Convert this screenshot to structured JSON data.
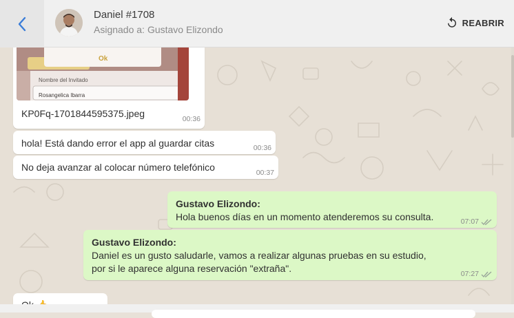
{
  "header": {
    "contact_name": "Daniel #1708",
    "assigned_label": "Asignado a:",
    "assigned_to": "Gustavo Elizondo",
    "reopen_label": "REABRIR"
  },
  "image_message": {
    "preview_field_label": "Nombre del Invitado",
    "preview_field_value": "Rosangelica Ibarra",
    "preview_ok": "Ok",
    "filename": "KP0Fq-1701844595375.jpeg",
    "time": "00:36"
  },
  "messages": [
    {
      "text": "hola! Está dando error el app al guardar citas",
      "time": "00:36"
    },
    {
      "text": "No deja avanzar al colocar número telefónico",
      "time": "00:37"
    },
    {
      "sender": "Gustavo Elizondo:",
      "lines": [
        "Hola buenos días en un momento atenderemos su consulta."
      ],
      "time": "07:07"
    },
    {
      "sender": "Gustavo Elizondo:",
      "lines": [
        "Daniel es un gusto saludarle, vamos a realizar algunas pruebas en su estudio,",
        "por si le aparece alguna reservación \"extraña\"."
      ],
      "time": "07:27"
    },
    {
      "text": "Ok 👍"
    }
  ]
}
